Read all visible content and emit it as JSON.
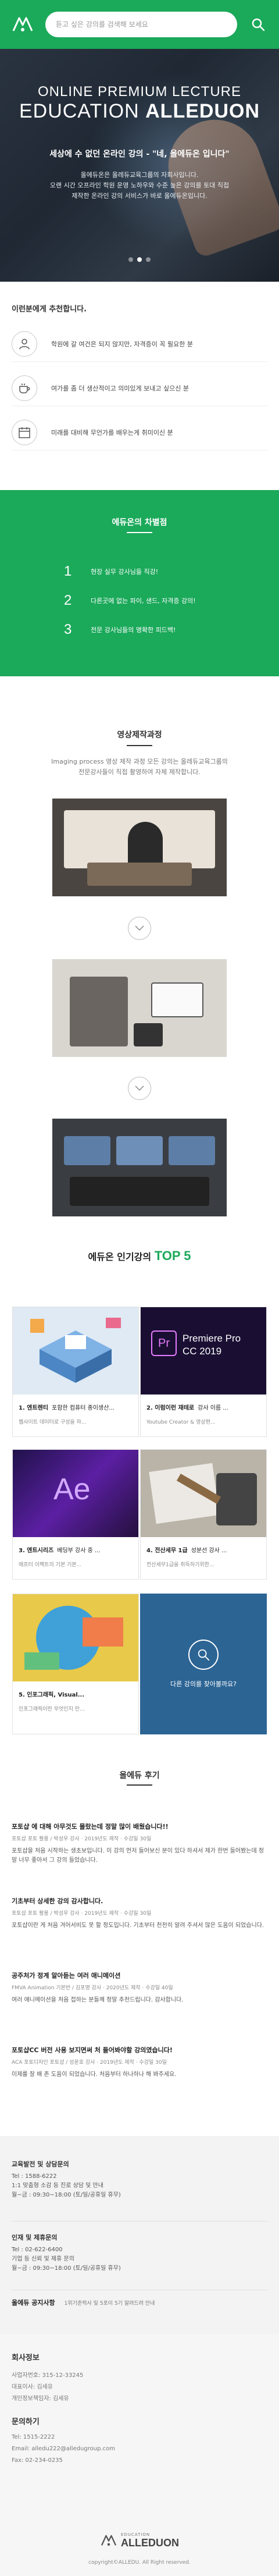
{
  "colors": {
    "brand": "#1ba95a",
    "more_card": "#2c6494",
    "top5": "#1ba95a"
  },
  "header": {
    "logo_icon": "alleduon-logo-mark",
    "search_placeholder": "듣고 싶은 강의를 검색해 보세요",
    "search_icon": "search-icon"
  },
  "hero": {
    "subtitle": "ONLINE PREMIUM LECTURE",
    "title_regular": "EDUCATION ",
    "title_bold": "ALLEDUON",
    "tagline": "세상에 수 없던 온라인 강의 - \"네, 올에듀온 입니다\"",
    "desc_line1": "올에듀온은 올레듀교육그룹의 자회사입니다.",
    "desc_line2": "오랜 시간 오프라인 학원 운영 노하우와 수준 높은 강의를 토대 직접",
    "desc_line3": "제작한 온라인 강의 서비스가 바로 올에듀온입니다.",
    "slides_total": 3,
    "slide_active": 2
  },
  "recommend": {
    "title": "이런분에게 추천합니다.",
    "items": [
      {
        "icon": "user-icon",
        "text": "학원에 갈 여건은 되지 않지만, 자격증이 꼭 필요한 분"
      },
      {
        "icon": "coffee-cup-icon",
        "text": "여가를 좀 더 생산적이고 의미있게 보내고 싶으신 분"
      },
      {
        "icon": "calendar-icon",
        "text": "미래를 대비해 무언가를 배우는게 취미이신 분"
      }
    ]
  },
  "features": {
    "title": "에듀온의 차별점",
    "items": [
      {
        "num": "1",
        "text": "현장 실무 강사님들 직강!"
      },
      {
        "num": "2",
        "text": "다른곳에 없는 파이, 샌드, 자격증 강의!"
      },
      {
        "num": "3",
        "text": "전문 강사님들의 명확한 피드백!"
      }
    ]
  },
  "production": {
    "title": "영상제작과정",
    "desc_line1": "Imaging process 영상 제작 과정 모든 강의는 올레듀교육그룹의",
    "desc_line2": "전문강사들이 직접 촬영하여 자체 제작합니다."
  },
  "top5": {
    "title_prefix": "에듀온 인기강의 ",
    "title_highlight": "TOP 5",
    "courses": [
      {
        "rank": "1. 엔트렌티",
        "title": "포함한 컴퓨터 종이생산...",
        "desc": "웹사이트 데이터로 구성을 하...",
        "thumb": "isometric"
      },
      {
        "rank": "2. 이럼이런 재테로",
        "title": "강사 이름 ...",
        "desc": "Youtube Creator & 영상편...",
        "thumb": "premiere",
        "thumb_title": "Premiere Pro",
        "thumb_sub": "CC 2019"
      },
      {
        "rank": "3. 엔트시리즈",
        "title": "베딩부 강사 중 ...",
        "desc": "애프터 이펙트의 기본 기본...",
        "thumb": "aftereffects",
        "thumb_title": "Ae"
      },
      {
        "rank": "4. 전산세무 1급",
        "title": "성분선 강사 ...",
        "desc": "전산세무1급을 취득하기위한...",
        "thumb": "finance"
      },
      {
        "rank": "5. 인포그래픽, Visual...",
        "title": "",
        "desc": "인포그래픽이란 무엇인지 만...",
        "thumb": "infographic"
      }
    ],
    "more_label": "다른 강의를 찾아볼까요?",
    "more_icon": "search-icon"
  },
  "reviews": {
    "title": "올에듀 후기",
    "items": [
      {
        "title": "포토샵 에 대해 아무것도 몰랐는데 정말 많이 배웠습니다!!",
        "meta": "포토샵 포토 활용 / 박성우 강사 · 2019년도 제작 · 수강일 30일",
        "body": "포토샵을 처음 시작하는 생초보입니다. 이 강의 먼저 들어보신 분이 있다 하셔서 제가 한번 들어봤는데 정말 너무 좋아서 그 강의 들었습니다."
      },
      {
        "title": "기초부터 상세한 강의 감사합니다.",
        "meta": "포토샵 포토 활용 / 박성우 강사 · 2019년도 제작 · 수강일 30일",
        "body": "포토샵이란 게 처음 겨어서비도 못 할 정도입니다. 기초부터 천천히 알려 주셔서 많은 도움이 되었습니다."
      },
      {
        "title": "공주처가 정계 알아듣는 여러 애니메이션",
        "meta": "FMVA Animation 기본반 / 김포명 강사 · 2020년도 제작 · 수강일 40일",
        "body": "여러 애니메이션을 처음 접하는 분들께 정말 추천드립니다. 감사합니다."
      },
      {
        "title": "포토샵CC 버전 사용 보지면써 처 들어봐야할 강의였습니다!",
        "meta": "ACA 포토디자인 포토샵 / 성윤호 강사 · 2019년도 제작 · 수강일 30일",
        "body": "이제를 잘 배 존 도움이 되었습니다. 처음부터 하나하나 해 봐주세요."
      }
    ]
  },
  "contacts": {
    "items": [
      {
        "title": "교육발전 및 상담문의",
        "lines": [
          "Tel : 1588-6222",
          "1:1 맞춤형 소감 등 진로 상담 및 안내",
          "월~금 : 09:30~18:00 (토/일/공휴일 휴무)"
        ]
      },
      {
        "title": "인재 및 제휴문의",
        "lines": [
          "Tel : 02-622-6400",
          "기업 등 신뢰 및 제휴 문의",
          "월~금 : 09:30~18:00 (토/일/공휴일 휴무)"
        ]
      }
    ],
    "biz_label": "올에듀 공지사항",
    "biz_value": "1위기준력사 및 5포이 5기 알려드려 안내"
  },
  "footer": {
    "company_title": "회사정보",
    "company_lines": [
      "사업자번호: 315-12-33245",
      "대표이사: 김세유",
      "개인정보책임자: 김세유"
    ],
    "contact_title": "문의하기",
    "contact_lines": [
      "Tel: 1515-2222",
      "Email: alledu222@alledugroup.com",
      "Fax: 02-234-0235"
    ],
    "logo_small": "EDUCATION",
    "logo_text": "ALLEDUON",
    "copyright": "copyright©ALLEDU. All Right reserved."
  }
}
